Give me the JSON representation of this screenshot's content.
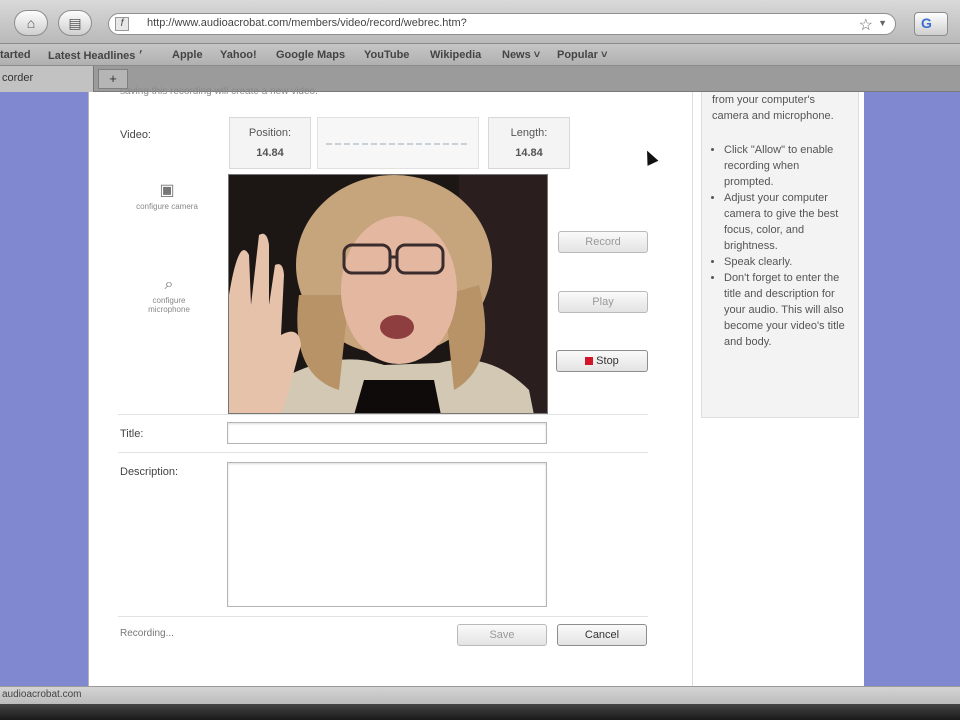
{
  "browser": {
    "url": "http://www.audioacrobat.com/members/video/record/webrec.htm?",
    "bookmarks": [
      "tarted",
      "Latest Headlines ׳",
      "Apple",
      "Yahoo!",
      "Google Maps",
      "YouTube",
      "Wikipedia",
      "News ˅",
      "Popular ˅"
    ],
    "tab_label": "corder",
    "new_tab_label": "+",
    "status_text": "audioacrobat.com"
  },
  "recorder": {
    "intro_text": "saving this recording will create a new video.",
    "video_label": "Video:",
    "position_label": "Position:",
    "position_value": "14.84",
    "length_label": "Length:",
    "length_value": "14.84",
    "configure_camera": "configure camera",
    "configure_microphone": "configure microphone",
    "record_label": "Record",
    "play_label": "Play",
    "stop_label": "Stop",
    "title_label": "Title:",
    "title_value": "",
    "description_label": "Description:",
    "description_value": "",
    "status_label": "Recording...",
    "save_label": "Save",
    "cancel_label": "Cancel"
  },
  "help": {
    "intro": "from your computer's camera and microphone.",
    "tips": [
      "Click \"Allow\" to enable recording when prompted.",
      "Adjust your computer camera to give the best focus, color, and brightness.",
      "Speak clearly.",
      "Don't forget to enter the title and description for your audio. This will also become your video's title and body."
    ]
  },
  "colors": {
    "page_background": "#8088cf",
    "stop_indicator": "#d0142a"
  }
}
